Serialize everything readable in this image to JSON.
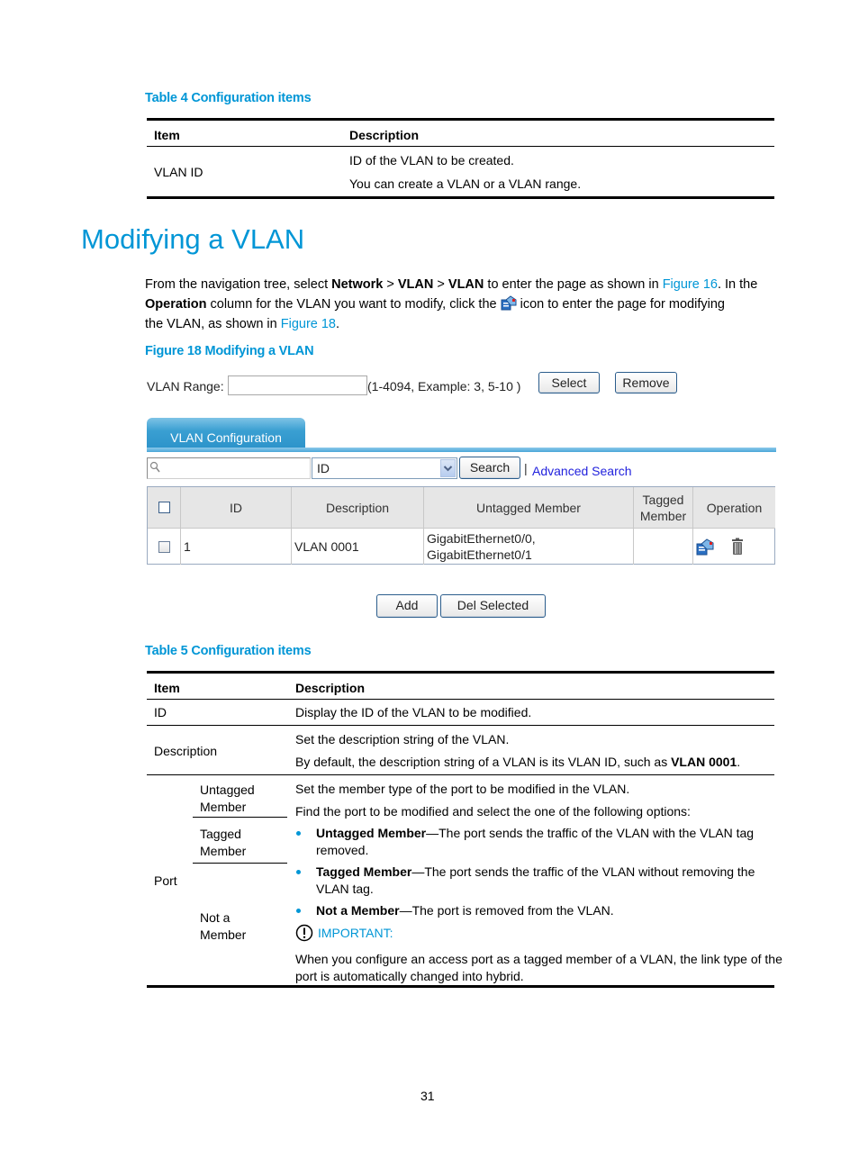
{
  "table4": {
    "caption": "Table 4 Configuration items",
    "headers": [
      "Item",
      "Description"
    ],
    "rows": [
      {
        "item": "VLAN ID",
        "description": [
          "ID of the VLAN to be created.",
          "You can create a VLAN or a VLAN range."
        ]
      }
    ]
  },
  "section": {
    "title": "Modifying a VLAN",
    "paragraph": {
      "p1": "From the navigation tree, select ",
      "b1": "Network",
      "s1": " > ",
      "b2": "VLAN",
      "s2": " > ",
      "b3": "VLAN",
      "p2": " to enter the page as shown in ",
      "link1": "Figure 16",
      "p3": ". In the",
      "b4": "Operation",
      "p4": " column for the VLAN you want to modify, click the ",
      "p5": " icon to enter the page for modifying",
      "p6": "the VLAN, as shown in ",
      "link2": "Figure 18",
      "p7": "."
    },
    "inline_icon": "modify-icon"
  },
  "figure18": {
    "caption": "Figure 18 Modifying a VLAN",
    "vlan_range": {
      "label": "VLAN Range:",
      "value": "",
      "hint": "(1-4094, Example: 3, 5-10 )",
      "select_button": "Select",
      "remove_button": "Remove"
    },
    "tab": {
      "label": "VLAN Configuration",
      "accent": "#2b92c9"
    },
    "search": {
      "input_value": "",
      "icon": "magnifier-icon",
      "field_select": "ID",
      "search_button": "Search",
      "separator": "|",
      "advanced_link": "Advanced Search"
    },
    "grid": {
      "headers": [
        "ID",
        "Description",
        "Untagged Member",
        "Tagged Member",
        "Operation"
      ],
      "rows": [
        {
          "checked": false,
          "id": "1",
          "description": "VLAN 0001",
          "untagged": [
            "GigabitEthernet0/0,",
            "GigabitEthernet0/1"
          ],
          "tagged": "",
          "operations": [
            "modify-icon",
            "delete-icon"
          ]
        }
      ]
    },
    "add_button": "Add",
    "del_selected_button": "Del Selected"
  },
  "table5": {
    "caption": "Table 5 Configuration items",
    "headers": [
      "Item",
      "Description"
    ],
    "rows": [
      {
        "item": "ID",
        "description": [
          "Display the ID of the VLAN to be modified."
        ]
      },
      {
        "item": "Description",
        "description": [
          "Set the description string of the VLAN.",
          "By default, the description string of a VLAN is its VLAN ID, such as ",
          "VLAN 0001",
          "."
        ]
      }
    ],
    "port": {
      "item": "Port",
      "subitems": [
        "Untagged Member",
        "Tagged Member",
        "Not a Member"
      ],
      "sub_lines": [
        [
          "Untagged",
          "Member"
        ],
        [
          "Tagged",
          "Member"
        ],
        [
          "Not a",
          "Member"
        ]
      ],
      "line1": "Set the member type of the port to be modified in the VLAN.",
      "line2": "Find the port to be modified and select the one of the following options:",
      "bullets": [
        {
          "term": "Untagged Member",
          "text": "—The port sends the traffic of the VLAN with the VLAN tag",
          "text2": "removed."
        },
        {
          "term": "Tagged Member",
          "text": "—The port sends the traffic of the VLAN without removing the",
          "text2": "VLAN tag."
        },
        {
          "term": "Not a Member",
          "text": "—The port is removed from the VLAN.",
          "text2": ""
        }
      ],
      "important_label": "IMPORTANT:",
      "important_text1": "When you configure an access port as a tagged member of a VLAN, the link type of the",
      "important_text2": "port is automatically changed into hybrid."
    }
  },
  "page_number": "31"
}
